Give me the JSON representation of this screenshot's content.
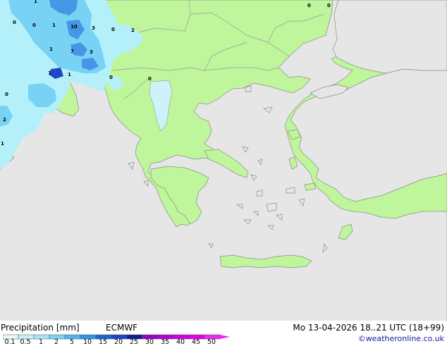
{
  "map": {
    "colors": {
      "sea": "#e6e6e6",
      "land": "#bff59b",
      "coast": "#8c8c8c",
      "border": "#9a9a9a",
      "precip_light": "#b4f0fa",
      "precip_mid": "#78d2f5",
      "precip_heavy": "#4696e6",
      "precip_max": "#1e46c8"
    },
    "value_labels": [
      "0",
      "1",
      "0",
      "1",
      "10",
      "3",
      "0",
      "2",
      "1",
      "7",
      "3",
      "1",
      "1",
      "0",
      "0",
      "0",
      "2",
      "1",
      "0",
      "0"
    ]
  },
  "footer": {
    "title": "Precipitation [mm]",
    "model": "ECMWF",
    "datetime": "Mo 13-04-2026 18..21 UTC (18+99)",
    "credit": "©weatheronline.co.uk",
    "scale_labels": [
      "0.1",
      "0.5",
      "1",
      "2",
      "5",
      "10",
      "15",
      "20",
      "25",
      "30",
      "35",
      "40",
      "45",
      "50"
    ],
    "scale_colors": [
      "#e6f8fc",
      "#c8f0fa",
      "#a8e4f8",
      "#78d2f5",
      "#50b4f0",
      "#2896e6",
      "#1e64d2",
      "#1e46c8",
      "#0a1e96",
      "#9600c8",
      "#b400dc",
      "#d200e6",
      "#e600f0",
      "#f028f5"
    ]
  }
}
